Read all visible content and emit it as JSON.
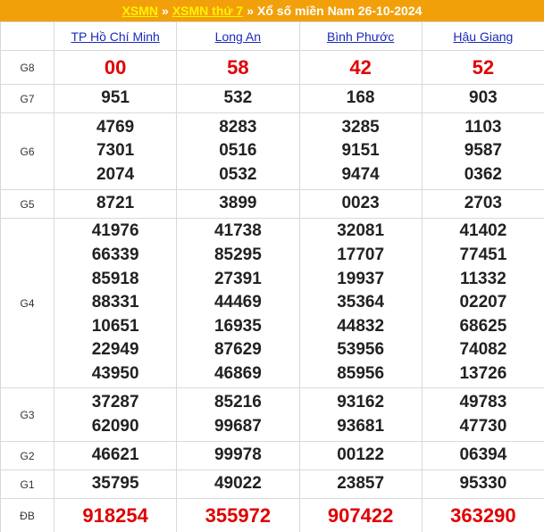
{
  "header": {
    "link1": "XSMN",
    "link2": "XSMN thứ 7",
    "separator": "»",
    "title": "Xổ số miền Nam 26-10-2024"
  },
  "provinces": [
    "TP Hồ Chí Minh",
    "Long An",
    "Bình Phước",
    "Hậu Giang"
  ],
  "labels": {
    "g8": "G8",
    "g7": "G7",
    "g6": "G6",
    "g5": "G5",
    "g4": "G4",
    "g3": "G3",
    "g2": "G2",
    "g1": "G1",
    "db": "ĐB"
  },
  "results": {
    "g8": [
      [
        "00"
      ],
      [
        "58"
      ],
      [
        "42"
      ],
      [
        "52"
      ]
    ],
    "g7": [
      [
        "951"
      ],
      [
        "532"
      ],
      [
        "168"
      ],
      [
        "903"
      ]
    ],
    "g6": [
      [
        "4769",
        "7301",
        "2074"
      ],
      [
        "8283",
        "0516",
        "0532"
      ],
      [
        "3285",
        "9151",
        "9474"
      ],
      [
        "1103",
        "9587",
        "0362"
      ]
    ],
    "g5": [
      [
        "8721"
      ],
      [
        "3899"
      ],
      [
        "0023"
      ],
      [
        "2703"
      ]
    ],
    "g4": [
      [
        "41976",
        "66339",
        "85918",
        "88331",
        "10651",
        "22949",
        "43950"
      ],
      [
        "41738",
        "85295",
        "27391",
        "44469",
        "16935",
        "87629",
        "46869"
      ],
      [
        "32081",
        "17707",
        "19937",
        "35364",
        "44832",
        "53956",
        "85956"
      ],
      [
        "41402",
        "77451",
        "11332",
        "02207",
        "68625",
        "74082",
        "13726"
      ]
    ],
    "g3": [
      [
        "37287",
        "62090"
      ],
      [
        "85216",
        "99687"
      ],
      [
        "93162",
        "93681"
      ],
      [
        "49783",
        "47730"
      ]
    ],
    "g2": [
      [
        "46621"
      ],
      [
        "99978"
      ],
      [
        "00122"
      ],
      [
        "06394"
      ]
    ],
    "g1": [
      [
        "35795"
      ],
      [
        "49022"
      ],
      [
        "23857"
      ],
      [
        "95330"
      ]
    ],
    "db": [
      [
        "918254"
      ],
      [
        "355972"
      ],
      [
        "907422"
      ],
      [
        "363290"
      ]
    ]
  }
}
